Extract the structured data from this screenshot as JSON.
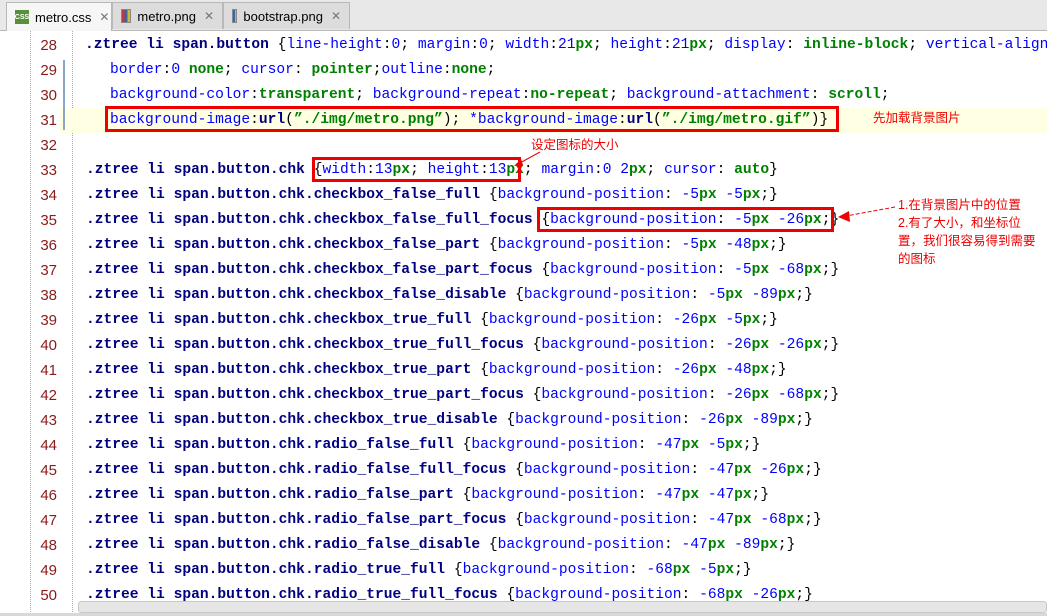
{
  "tabs": [
    {
      "label": "metro.css",
      "icon": "css-file-icon",
      "active": true
    },
    {
      "label": "metro.png",
      "icon": "image-file-icon"
    },
    {
      "label": "bootstrap.png",
      "icon": "image-file-icon"
    }
  ],
  "lines": [
    {
      "num": "28",
      "indent": 0,
      "tokens": [
        [
          "s",
          ".ztree li span.button "
        ],
        [
          "x",
          "{"
        ],
        [
          "p",
          "line-height"
        ],
        [
          "x",
          ":"
        ],
        [
          "n",
          "0"
        ],
        [
          "x",
          "; "
        ],
        [
          "p",
          "margin"
        ],
        [
          "x",
          ":"
        ],
        [
          "n",
          "0"
        ],
        [
          "x",
          "; "
        ],
        [
          "p",
          "width"
        ],
        [
          "x",
          ":"
        ],
        [
          "n",
          "21"
        ],
        [
          "u",
          "px"
        ],
        [
          "x",
          "; "
        ],
        [
          "p",
          "height"
        ],
        [
          "x",
          ":"
        ],
        [
          "n",
          "21"
        ],
        [
          "u",
          "px"
        ],
        [
          "x",
          "; "
        ],
        [
          "p",
          "display"
        ],
        [
          "x",
          ": "
        ],
        [
          "v",
          "inline-block"
        ],
        [
          "x",
          "; "
        ],
        [
          "p",
          "vertical-align"
        ],
        [
          "x",
          ":"
        ]
      ]
    },
    {
      "num": "29",
      "indent": 4,
      "tokens": [
        [
          "p",
          "border"
        ],
        [
          "x",
          ":"
        ],
        [
          "n",
          "0"
        ],
        [
          "v",
          " none"
        ],
        [
          "x",
          "; "
        ],
        [
          "p",
          "cursor"
        ],
        [
          "x",
          ": "
        ],
        [
          "v",
          "pointer"
        ],
        [
          "x",
          ";"
        ],
        [
          "p",
          "outline"
        ],
        [
          "x",
          ":"
        ],
        [
          "v",
          "none"
        ],
        [
          "x",
          ";"
        ]
      ]
    },
    {
      "num": "30",
      "indent": 4,
      "tokens": [
        [
          "p",
          "background-color"
        ],
        [
          "x",
          ":"
        ],
        [
          "v",
          "transparent"
        ],
        [
          "x",
          "; "
        ],
        [
          "p",
          "background-repeat"
        ],
        [
          "x",
          ":"
        ],
        [
          "v",
          "no-repeat"
        ],
        [
          "x",
          "; "
        ],
        [
          "p",
          "background-attachment"
        ],
        [
          "x",
          ": "
        ],
        [
          "v",
          "scroll"
        ],
        [
          "x",
          ";"
        ]
      ]
    },
    {
      "num": "31",
      "indent": 4,
      "hl": true,
      "tokens": [
        [
          "p",
          "background-image"
        ],
        [
          "x",
          ":"
        ],
        [
          "s",
          "url"
        ],
        [
          "x",
          "("
        ],
        [
          "v",
          "”./img/metro.png”"
        ],
        [
          "x",
          "); "
        ],
        [
          "p",
          "*background-image"
        ],
        [
          "x",
          ":"
        ],
        [
          "s",
          "url"
        ],
        [
          "x",
          "("
        ],
        [
          "v",
          "”./img/metro.gif”"
        ],
        [
          "x",
          ")}"
        ]
      ]
    },
    {
      "num": "32",
      "indent": 0,
      "tokens": []
    },
    {
      "num": "33",
      "indent": 1,
      "tokens": [
        [
          "s",
          ".ztree li span.button.chk "
        ],
        [
          "x",
          "{"
        ],
        [
          "p",
          "width"
        ],
        [
          "x",
          ":"
        ],
        [
          "n",
          "13"
        ],
        [
          "u",
          "px"
        ],
        [
          "x",
          "; "
        ],
        [
          "p",
          "height"
        ],
        [
          "x",
          ":"
        ],
        [
          "n",
          "13"
        ],
        [
          "u",
          "px"
        ],
        [
          "x",
          "; "
        ],
        [
          "p",
          "margin"
        ],
        [
          "x",
          ":"
        ],
        [
          "n",
          "0 2"
        ],
        [
          "u",
          "px"
        ],
        [
          "x",
          "; "
        ],
        [
          "p",
          "cursor"
        ],
        [
          "x",
          ": "
        ],
        [
          "v",
          "auto"
        ],
        [
          "x",
          "}"
        ]
      ]
    }
  ],
  "position_rules": [
    {
      "num": "34",
      "selector": ".ztree li span.button.chk.checkbox_false_full ",
      "x": "-5",
      "y": "-5"
    },
    {
      "num": "35",
      "selector": ".ztree li span.button.chk.checkbox_false_full_focus ",
      "x": "-5",
      "y": "-26"
    },
    {
      "num": "36",
      "selector": ".ztree li span.button.chk.checkbox_false_part ",
      "x": "-5",
      "y": "-48"
    },
    {
      "num": "37",
      "selector": ".ztree li span.button.chk.checkbox_false_part_focus ",
      "x": "-5",
      "y": "-68"
    },
    {
      "num": "38",
      "selector": ".ztree li span.button.chk.checkbox_false_disable ",
      "x": "-5",
      "y": "-89"
    },
    {
      "num": "39",
      "selector": ".ztree li span.button.chk.checkbox_true_full ",
      "x": "-26",
      "y": "-5"
    },
    {
      "num": "40",
      "selector": ".ztree li span.button.chk.checkbox_true_full_focus ",
      "x": "-26",
      "y": "-26"
    },
    {
      "num": "41",
      "selector": ".ztree li span.button.chk.checkbox_true_part ",
      "x": "-26",
      "y": "-48"
    },
    {
      "num": "42",
      "selector": ".ztree li span.button.chk.checkbox_true_part_focus ",
      "x": "-26",
      "y": "-68"
    },
    {
      "num": "43",
      "selector": ".ztree li span.button.chk.checkbox_true_disable ",
      "x": "-26",
      "y": "-89"
    },
    {
      "num": "44",
      "selector": ".ztree li span.button.chk.radio_false_full ",
      "x": "-47",
      "y": "-5"
    },
    {
      "num": "45",
      "selector": ".ztree li span.button.chk.radio_false_full_focus ",
      "x": "-47",
      "y": "-26"
    },
    {
      "num": "46",
      "selector": ".ztree li span.button.chk.radio_false_part ",
      "x": "-47",
      "y": "-47"
    },
    {
      "num": "47",
      "selector": ".ztree li span.button.chk.radio_false_part_focus ",
      "x": "-47",
      "y": "-68"
    },
    {
      "num": "48",
      "selector": ".ztree li span.button.chk.radio_false_disable ",
      "x": "-47",
      "y": "-89"
    },
    {
      "num": "49",
      "selector": ".ztree li span.button.chk.radio_true_full ",
      "x": "-68",
      "y": "-5"
    },
    {
      "num": "50",
      "selector": ".ztree li span.button.chk.radio_true_full_focus ",
      "x": "-68",
      "y": "-26"
    }
  ],
  "annotations": {
    "load_bg": "先加载背景图片",
    "set_size": "设定图标的大小",
    "position_note": [
      "1.在背景图片中的位置",
      "2.有了大小，和坐标位",
      "置，我们很容易得到需要",
      "的图标"
    ]
  },
  "colors": {
    "annotation": "#ee0000",
    "selector": "#000080",
    "property": "#0000ff",
    "value": "#008000"
  }
}
